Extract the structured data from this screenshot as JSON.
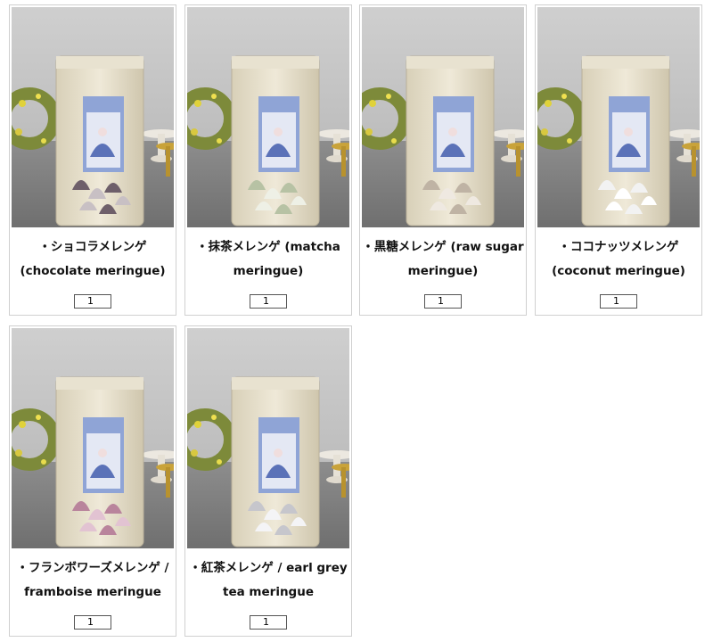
{
  "products": [
    {
      "line1": "・ショコラメレンゲ",
      "line2": "(chocolate meringue)",
      "qty": "1",
      "candy": "#6e5f6a",
      "candy2": "#c8c0c4"
    },
    {
      "line1": "・抹茶メレンゲ (matcha",
      "line2": "meringue)",
      "qty": "1",
      "candy": "#b7c2a4",
      "candy2": "#eef0e6"
    },
    {
      "line1": "・黒糖メレンゲ (raw sugar",
      "line2": "meringue)",
      "qty": "1",
      "candy": "#bfb3a4",
      "candy2": "#efe9e1"
    },
    {
      "line1": "・ココナッツメレンゲ",
      "line2": "(coconut meringue)",
      "qty": "1",
      "candy": "#f2f2f2",
      "candy2": "#ffffff"
    },
    {
      "line1": "・フランボワーズメレンゲ /",
      "line2": "framboise meringue",
      "qty": "1",
      "candy": "#b9849c",
      "candy2": "#e2c3d2"
    },
    {
      "line1": "・紅茶メレンゲ / earl grey",
      "line2": "tea meringue",
      "qty": "1",
      "candy": "#c6c6cc",
      "candy2": "#f4f4f6"
    }
  ]
}
